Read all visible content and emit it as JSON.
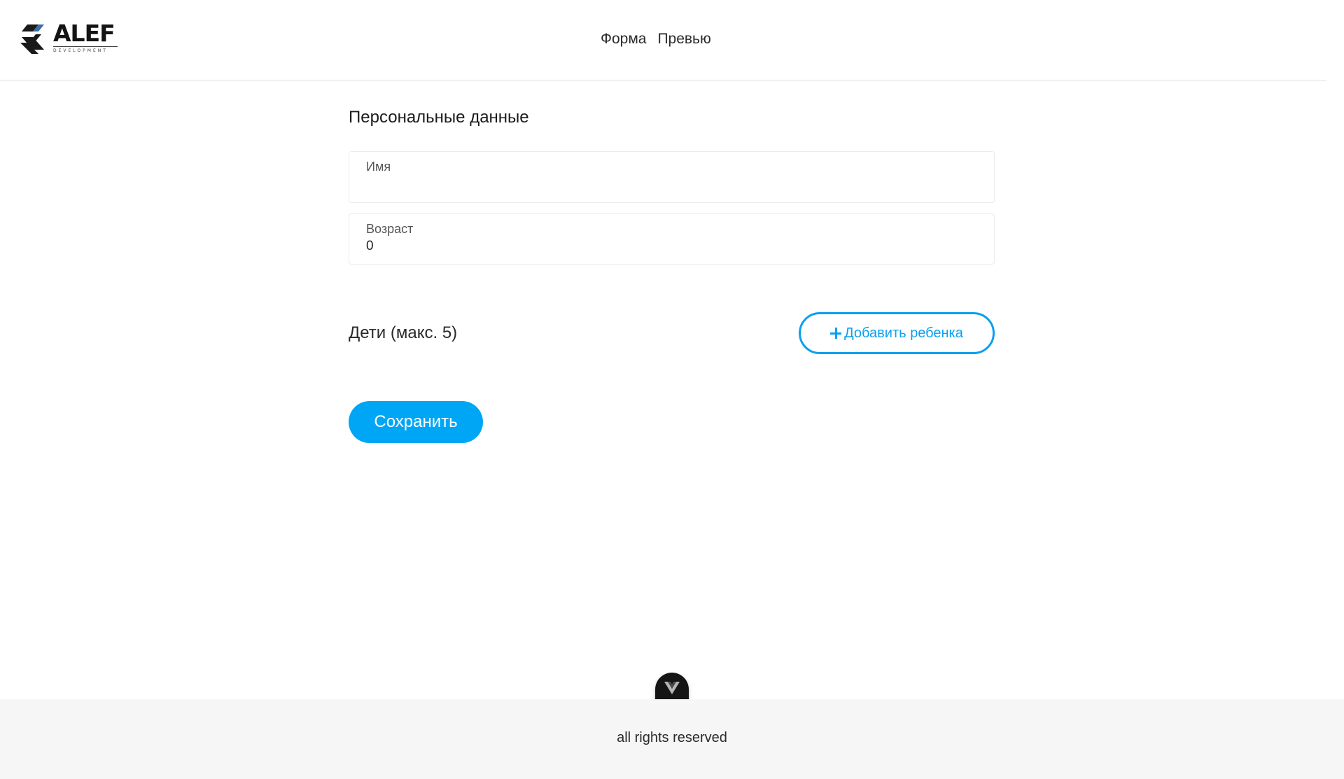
{
  "brand": {
    "logo_word": "ALEF",
    "logo_sub": "DEVELOPMENT"
  },
  "nav": {
    "items": [
      {
        "label": "Форма"
      },
      {
        "label": "Превью"
      }
    ]
  },
  "form": {
    "section_title": "Персональные данные",
    "name_field": {
      "label": "Имя",
      "value": ""
    },
    "age_field": {
      "label": "Возраст",
      "value": "0"
    },
    "children_title": "Дети (макс. 5)",
    "add_child_label": "Добавить ребенка",
    "save_label": "Сохранить"
  },
  "footer": {
    "text": "all rights reserved"
  },
  "colors": {
    "accent": "#00a6f6",
    "outline": "#0aa0ef",
    "footer_bg": "#f6f6f6"
  },
  "icons": {
    "logo": "alef-logo-icon",
    "add": "plus-icon",
    "badge": "vue-icon"
  }
}
